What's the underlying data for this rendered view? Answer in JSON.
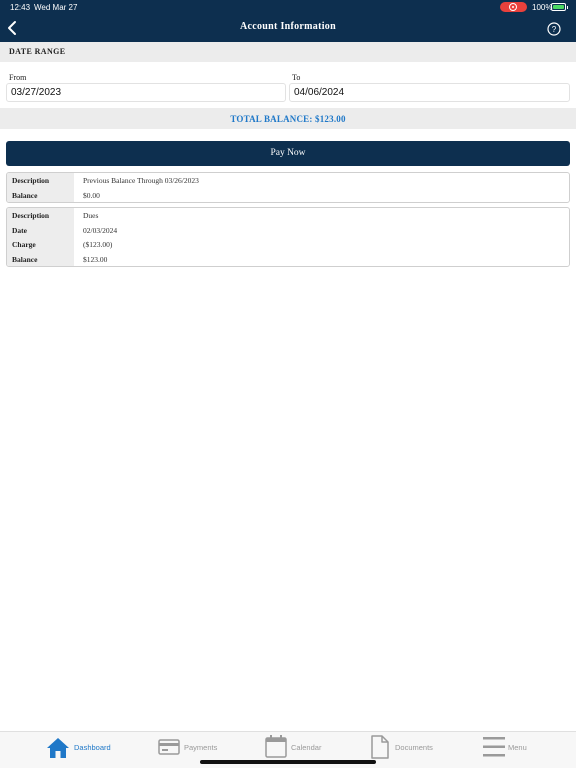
{
  "status_bar": {
    "time": "12:43",
    "date": "Wed Mar 27",
    "battery_pct": "100%",
    "battery_level": 1.0
  },
  "header": {
    "title": "Account Information",
    "back_icon": "chevron-left-icon",
    "help_icon": "question-circle-icon"
  },
  "date_range": {
    "section_title": "DATE RANGE",
    "from_label": "From",
    "from_value": "03/27/2023",
    "to_label": "To",
    "to_value": "04/06/2024"
  },
  "total_balance": "TOTAL BALANCE: $123.00",
  "pay_button_label": "Pay Now",
  "cards": [
    {
      "rows": [
        {
          "label": "Description",
          "value": "Previous Balance Through 03/26/2023"
        },
        {
          "label": "Balance",
          "value": "$0.00"
        }
      ]
    },
    {
      "rows": [
        {
          "label": "Description",
          "value": "Dues"
        },
        {
          "label": "Date",
          "value": "02/03/2024"
        },
        {
          "label": "Charge",
          "value": "($123.00)"
        },
        {
          "label": "Balance",
          "value": "$123.00"
        }
      ]
    }
  ],
  "tabs": [
    {
      "label": "Dashboard",
      "icon": "home-icon",
      "active": true
    },
    {
      "label": "Payments",
      "icon": "credit-card-icon",
      "active": false
    },
    {
      "label": "Calendar",
      "icon": "calendar-icon",
      "active": false
    },
    {
      "label": "Documents",
      "icon": "document-icon",
      "active": false
    },
    {
      "label": "Menu",
      "icon": "hamburger-menu-icon",
      "active": false
    }
  ],
  "colors": {
    "header_bg": "#0d2f4f",
    "accent": "#1f78c8",
    "inactive_tab": "#999999"
  }
}
